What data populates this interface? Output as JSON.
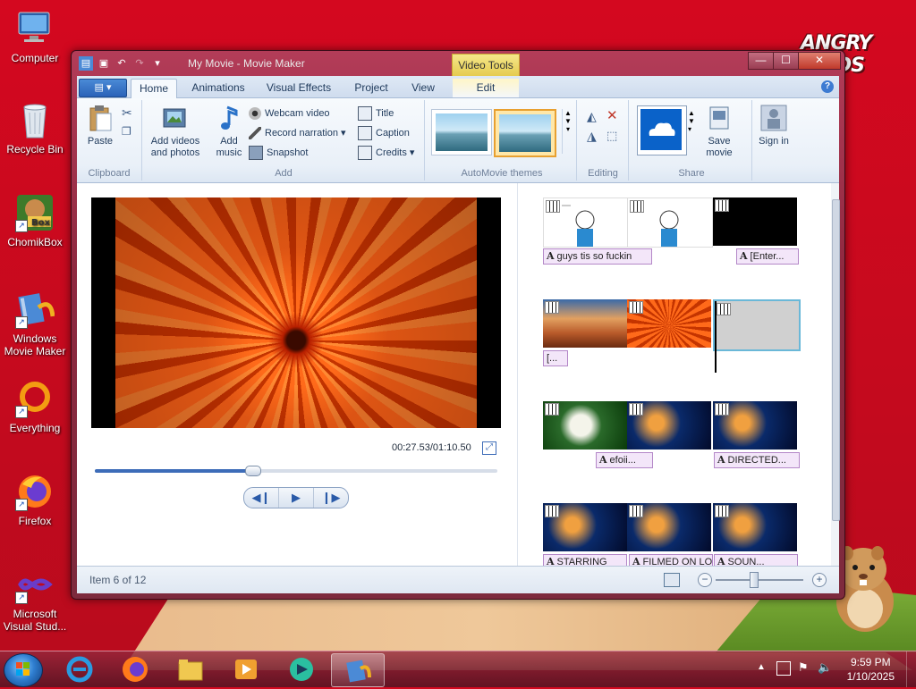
{
  "desktop": {
    "wallpaper_logo": "ANGRY BIRDS",
    "icons": [
      {
        "label": "Computer"
      },
      {
        "label": "Recycle Bin"
      },
      {
        "label": "ChomikBox"
      },
      {
        "label": "Windows Movie Maker"
      },
      {
        "label": "Everything"
      },
      {
        "label": "Firefox"
      },
      {
        "label": "Microsoft Visual Stud..."
      }
    ]
  },
  "window": {
    "title": "My Movie - Movie Maker",
    "contextual_tab_group": "Video Tools",
    "controls": {
      "minimize": "—",
      "maximize": "☐",
      "close": "✕"
    }
  },
  "ribbon": {
    "file_button": "▤ ▾",
    "tabs": [
      "Home",
      "Animations",
      "Visual Effects",
      "Project",
      "View",
      "Edit"
    ],
    "active_tab": "Home",
    "help": "?",
    "groups": {
      "clipboard": {
        "label": "Clipboard",
        "paste": "Paste"
      },
      "add": {
        "label": "Add",
        "add_videos": "Add videos and photos",
        "add_music": "Add music",
        "webcam": "Webcam video",
        "narration": "Record narration",
        "snapshot": "Snapshot",
        "title": "Title",
        "caption": "Caption",
        "credits": "Credits"
      },
      "themes": {
        "label": "AutoMovie themes"
      },
      "editing": {
        "label": "Editing"
      },
      "share": {
        "label": "Share",
        "save_movie": "Save movie",
        "sign_in": "Sign in"
      }
    }
  },
  "preview": {
    "timecode": "00:27.53/01:10.50",
    "progress": 0.39,
    "controls": {
      "prev": "◀❙",
      "play": "▶",
      "next": "❙▶"
    }
  },
  "storyboard": {
    "captions": [
      "guys tis so fuckin",
      "[Enter...",
      "[...",
      "efoii...",
      "DIRECTED...",
      "STARRING",
      "FILMED ON LO",
      "SOUN..."
    ]
  },
  "statusbar": {
    "item": "Item 6 of 12",
    "zoom_out": "−",
    "zoom_in": "+"
  },
  "taskbar": {
    "clock_time": "9:59 PM",
    "clock_date": "1/10/2025"
  },
  "colors": {
    "accent": "#3d6cb8",
    "titlebar": "#8f2940",
    "wallpaper": "#c50a1e"
  }
}
